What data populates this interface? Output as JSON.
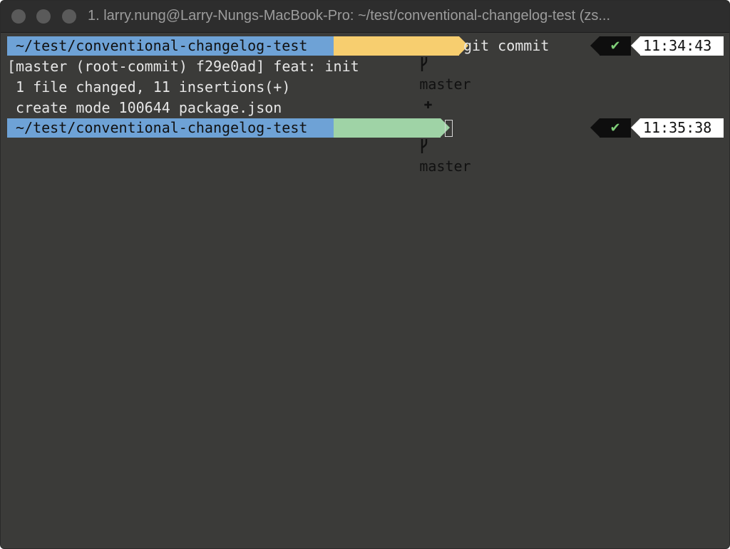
{
  "window": {
    "title": "1. larry.nung@Larry-Nungs-MacBook-Pro: ~/test/conventional-changelog-test (zs...",
    "traffic_lights": [
      "close",
      "minimize",
      "zoom"
    ]
  },
  "prompt1": {
    "cwd": "~/test/conventional-changelog-test",
    "branch": "master",
    "dirty_icon": "plus-icon",
    "dirty_glyph": "✚",
    "command": "git commit",
    "status_glyph": "✔",
    "time": "11:34:43"
  },
  "output": [
    "[master (root-commit) f29e0ad] feat: init",
    " 1 file changed, 11 insertions(+)",
    " create mode 100644 package.json"
  ],
  "prompt2": {
    "cwd": "~/test/conventional-changelog-test",
    "branch": "master",
    "status_glyph": "✔",
    "time": "11:35:38"
  },
  "colors": {
    "background": "#3b3b39",
    "cwd_segment": "#6ea2d6",
    "dirty_branch_segment": "#f7ce6f",
    "clean_branch_segment": "#9fd3a6",
    "status_ok": "#7fce78"
  }
}
